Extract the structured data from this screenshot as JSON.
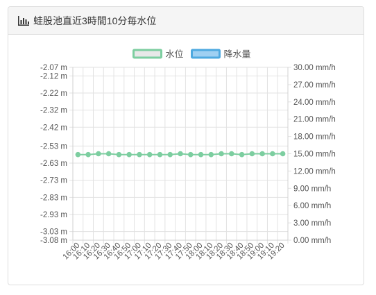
{
  "panel": {
    "title": "蛙股池直近3時間10分毎水位",
    "icon": "bar-chart-icon"
  },
  "chart_data": {
    "type": "line",
    "legend": [
      {
        "name": "水位",
        "color": "#7dcea0",
        "fill": "#e8e8e8"
      },
      {
        "name": "降水量",
        "color": "#4ea9e0",
        "fill": "#9fd0f2"
      }
    ],
    "legend_position": "top-center",
    "x": [
      "16:00",
      "16:10",
      "16:20",
      "16:30",
      "16:40",
      "16:50",
      "17:00",
      "17:10",
      "17:20",
      "17:30",
      "17:40",
      "17:50",
      "18:00",
      "18:10",
      "18:20",
      "18:30",
      "18:40",
      "18:50",
      "19:00",
      "19:10",
      "19:20"
    ],
    "series": [
      {
        "name": "水位",
        "axis": "left",
        "color": "#7dcea0",
        "values": [
          -2.58,
          -2.58,
          -2.575,
          -2.575,
          -2.58,
          -2.58,
          -2.58,
          -2.58,
          -2.58,
          -2.58,
          -2.575,
          -2.58,
          -2.58,
          -2.58,
          -2.575,
          -2.575,
          -2.58,
          -2.575,
          -2.575,
          -2.575,
          -2.575
        ]
      }
    ],
    "y_left": {
      "range": [
        -3.08,
        -2.07
      ],
      "ticks": [
        -2.07,
        -2.12,
        -2.22,
        -2.32,
        -2.42,
        -2.53,
        -2.63,
        -2.73,
        -2.83,
        -2.93,
        -3.03,
        -3.08
      ],
      "labels": [
        "-2.07 m",
        "-2.12 m",
        "-2.22 m",
        "-2.32 m",
        "-2.42 m",
        "-2.53 m",
        "-2.63 m",
        "-2.73 m",
        "-2.83 m",
        "-2.93 m",
        "-3.03 m",
        "-3.08 m"
      ]
    },
    "y_right": {
      "range": [
        0,
        30
      ],
      "ticks": [
        0,
        3,
        6,
        9,
        12,
        15,
        18,
        21,
        24,
        27,
        30
      ],
      "labels": [
        "0.00 mm/h",
        "3.00 mm/h",
        "6.00 mm/h",
        "9.00 mm/h",
        "12.00 mm/h",
        "15.00 mm/h",
        "18.00 mm/h",
        "21.00 mm/h",
        "24.00 mm/h",
        "27.00 mm/h",
        "30.00 mm/h"
      ]
    },
    "grid": true
  }
}
